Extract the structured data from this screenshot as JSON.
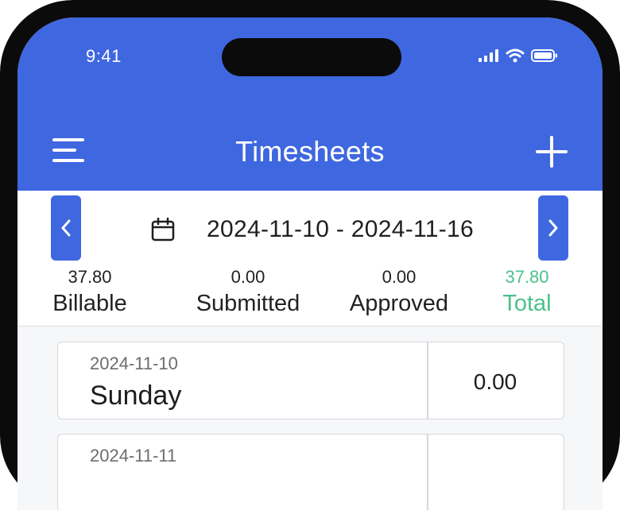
{
  "status_bar": {
    "time": "9:41"
  },
  "header": {
    "title": "Timesheets",
    "menu_icon": "menu-icon",
    "add_icon": "plus-icon"
  },
  "week": {
    "range": "2024-11-10 - 2024-11-16",
    "calendar_icon": "calendar-icon",
    "prev_icon": "chevron-left-icon",
    "next_icon": "chevron-right-icon"
  },
  "summary": [
    {
      "value": "37.80",
      "label": "Billable"
    },
    {
      "value": "0.00",
      "label": "Submitted"
    },
    {
      "value": "0.00",
      "label": "Approved"
    },
    {
      "value": "37.80",
      "label": "Total"
    }
  ],
  "days": [
    {
      "date": "2024-11-10",
      "day": "Sunday",
      "hours": "0.00"
    },
    {
      "date": "2024-11-11",
      "day": "",
      "hours": ""
    }
  ],
  "colors": {
    "primary": "#3f67e0",
    "total_green": "#4cc08b",
    "background": "#f6f7f9"
  }
}
